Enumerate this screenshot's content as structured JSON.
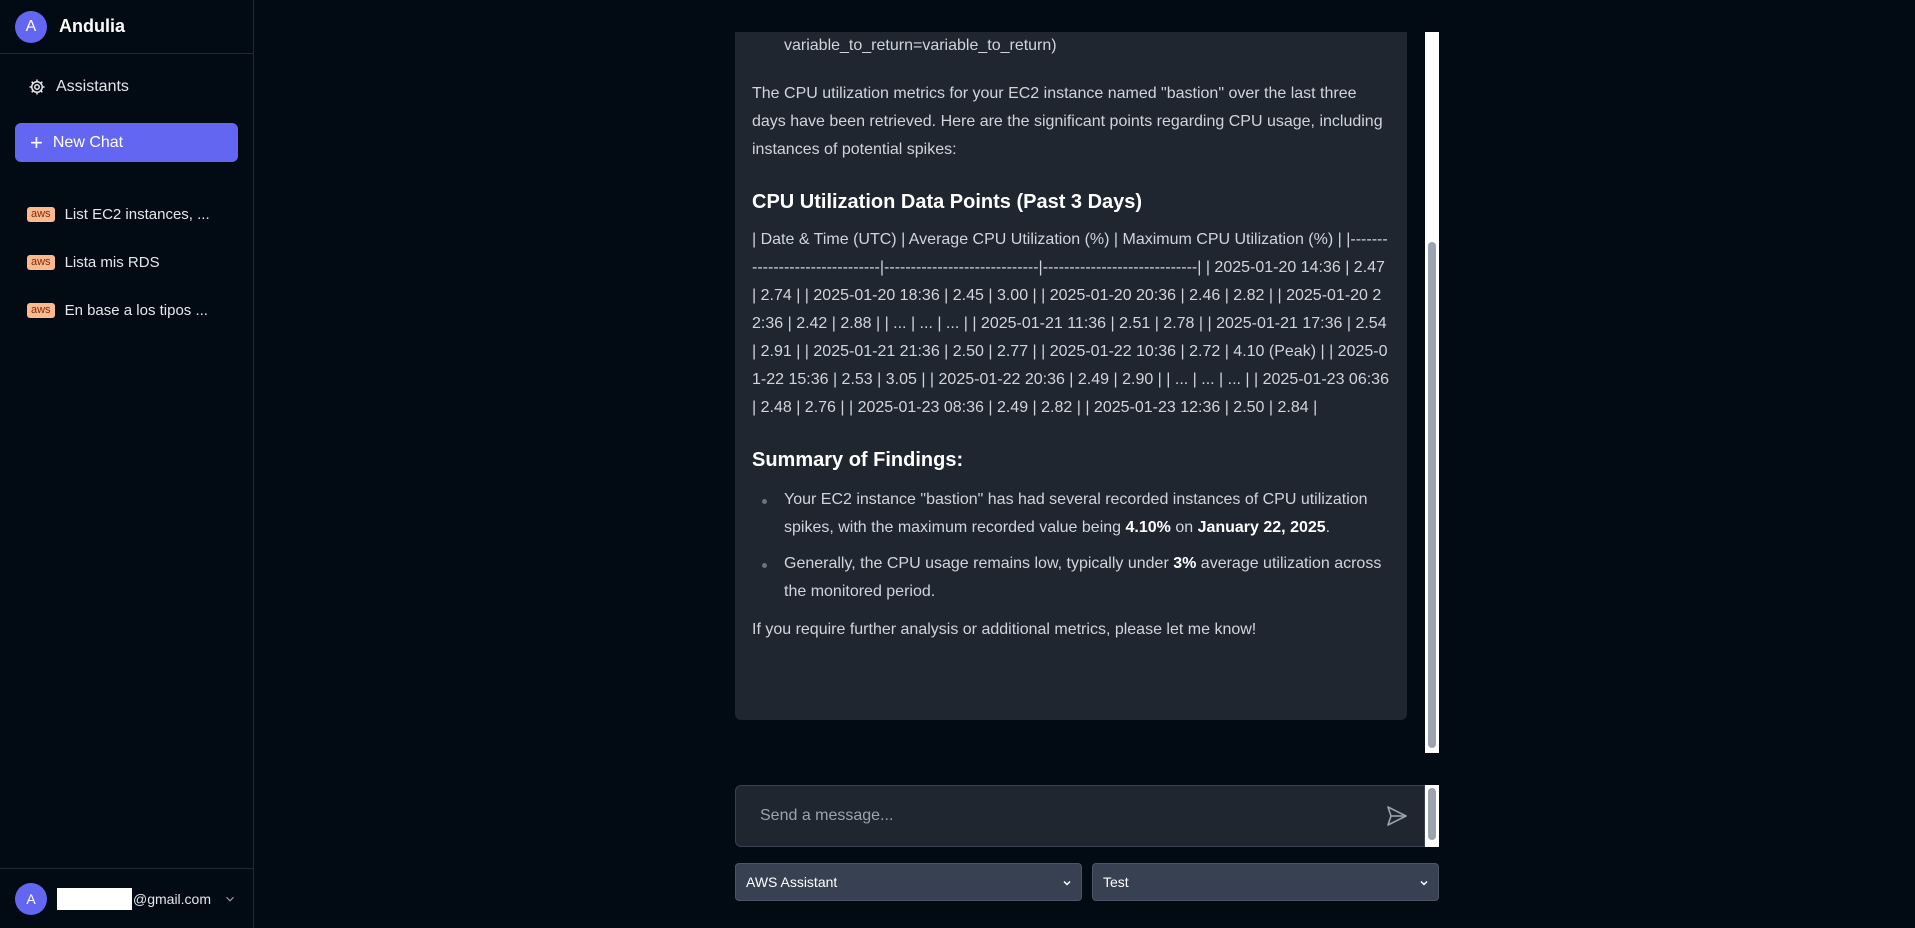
{
  "sidebar": {
    "brand_initial": "A",
    "brand_name": "Andulia",
    "assistants_label": "Assistants",
    "new_chat_label": "New Chat",
    "chats": [
      {
        "tag": "aws",
        "title": "List EC2 instances, ..."
      },
      {
        "tag": "aws",
        "title": "Lista mis RDS"
      },
      {
        "tag": "aws",
        "title": "En base a los tipos ..."
      }
    ],
    "user_initial": "A",
    "user_email_suffix": "@gmail.com"
  },
  "message": {
    "code_line": "variable_to_return=variable_to_return)",
    "intro": "The CPU utilization metrics for your EC2 instance named \"bastion\" over the last three days have been retrieved. Here are the significant points regarding CPU usage, including instances of potential spikes:",
    "heading_data": "CPU Utilization Data Points (Past 3 Days)",
    "table_raw": "| Date & Time (UTC) | Average CPU Utilization (%) | Maximum CPU Utilization (%) | |-------------------------------|-----------------------------|-----------------------------| | 2025-01-20 14:36 | 2.47 | 2.74 | | 2025-01-20 18:36 | 2.45 | 3.00 | | 2025-01-20 20:36 | 2.46 | 2.82 | | 2025-01-20 22:36 | 2.42 | 2.88 | | ... | ... | ... | | 2025-01-21 11:36 | 2.51 | 2.78 | | 2025-01-21 17:36 | 2.54 | 2.91 | | 2025-01-21 21:36 | 2.50 | 2.77 | | 2025-01-22 10:36 | 2.72 | 4.10 (Peak) | | 2025-01-22 15:36 | 2.53 | 3.05 | | 2025-01-22 20:36 | 2.49 | 2.90 | | ... | ... | ... | | 2025-01-23 06:36 | 2.48 | 2.76 | | 2025-01-23 08:36 | 2.49 | 2.82 | | 2025-01-23 12:36 | 2.50 | 2.84 |",
    "heading_summary": "Summary of Findings:",
    "finding1_pre": "Your EC2 instance \"bastion\" has had several recorded instances of CPU utilization spikes, with the maximum recorded value being ",
    "finding1_bold1": "4.10%",
    "finding1_mid": " on ",
    "finding1_bold2": "January 22, 2025",
    "finding1_post": ".",
    "finding2_pre": "Generally, the CPU usage remains low, typically under ",
    "finding2_bold": "3%",
    "finding2_post": " average utilization across the monitored period.",
    "closing": "If you require further analysis or additional metrics, please let me know!"
  },
  "input": {
    "placeholder": "Send a message..."
  },
  "selects": {
    "assistant": "AWS Assistant",
    "model": "Test"
  },
  "colors": {
    "accent": "#6366f1",
    "background": "#020b13",
    "message_bg": "#1f2630",
    "tag_bg": "#fdba8c"
  }
}
